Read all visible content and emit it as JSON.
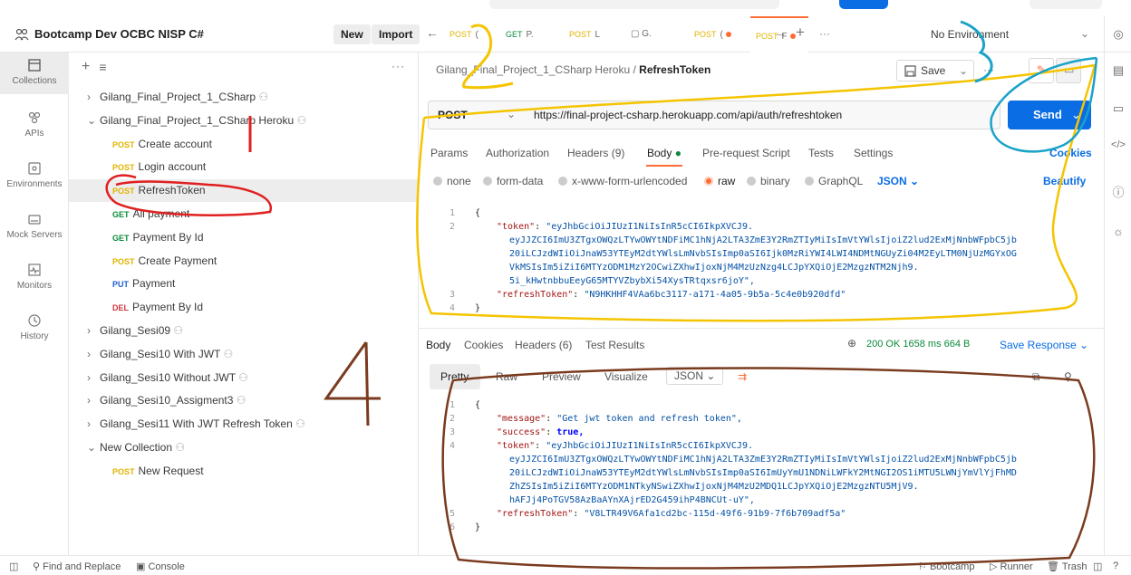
{
  "workspace": {
    "name": "Bootcamp Dev OCBC NISP C#",
    "new_label": "New",
    "import_label": "Import"
  },
  "rail": [
    {
      "label": "Collections",
      "icon": "collections-icon"
    },
    {
      "label": "APIs",
      "icon": "apis-icon"
    },
    {
      "label": "Environments",
      "icon": "environments-icon"
    },
    {
      "label": "Mock Servers",
      "icon": "mock-servers-icon"
    },
    {
      "label": "Monitors",
      "icon": "monitors-icon"
    },
    {
      "label": "History",
      "icon": "history-icon"
    }
  ],
  "tree": [
    {
      "kind": "collection",
      "label": "Gilang_Final_Project_1_CSharp",
      "expanded": false
    },
    {
      "kind": "collection",
      "label": "Gilang_Final_Project_1_CSharp Heroku",
      "expanded": true
    },
    {
      "kind": "request",
      "method": "POST",
      "label": "Create account"
    },
    {
      "kind": "request",
      "method": "POST",
      "label": "Login account"
    },
    {
      "kind": "request",
      "method": "POST",
      "label": "RefreshToken",
      "selected": true
    },
    {
      "kind": "request",
      "method": "GET",
      "label": "All payment"
    },
    {
      "kind": "request",
      "method": "GET",
      "label": "Payment By Id"
    },
    {
      "kind": "request",
      "method": "POST",
      "label": "Create Payment"
    },
    {
      "kind": "request",
      "method": "PUT",
      "label": "Payment"
    },
    {
      "kind": "request",
      "method": "DEL",
      "label": "Payment By Id"
    },
    {
      "kind": "collection",
      "label": "Gilang_Sesi09",
      "expanded": false
    },
    {
      "kind": "collection",
      "label": "Gilang_Sesi10 With JWT",
      "expanded": false
    },
    {
      "kind": "collection",
      "label": "Gilang_Sesi10 Without JWT",
      "expanded": false
    },
    {
      "kind": "collection",
      "label": "Gilang_Sesi10_Assigment3",
      "expanded": false
    },
    {
      "kind": "collection",
      "label": "Gilang_Sesi11 With JWT Refresh Token",
      "expanded": false
    },
    {
      "kind": "collection",
      "label": "New Collection",
      "expanded": true
    },
    {
      "kind": "request",
      "method": "POST",
      "label": "New Request"
    }
  ],
  "tabs": {
    "items": [
      {
        "method": "POST",
        "label": "("
      },
      {
        "method": "GET",
        "label": "P."
      },
      {
        "method": "POST",
        "label": "L"
      },
      {
        "method": "",
        "label": "G."
      },
      {
        "method": "POST",
        "label": "(",
        "unsaved": true
      },
      {
        "method": "POST",
        "label": "F",
        "unsaved": true,
        "active": true
      }
    ],
    "environment": "No Environment"
  },
  "request": {
    "breadcrumb_parent": "Gilang_Final_Project_1_CSharp Heroku",
    "breadcrumb_sep": "/",
    "breadcrumb_current": "RefreshToken",
    "save_label": "Save",
    "method": "POST",
    "url": "https://final-project-csharp.herokuapp.com/api/auth/refreshtoken",
    "send_label": "Send",
    "subtabs": [
      "Params",
      "Authorization",
      "Headers (9)",
      "Body",
      "Pre-request Script",
      "Tests",
      "Settings"
    ],
    "cookies_label": "Cookies",
    "body_types": [
      "none",
      "form-data",
      "x-www-form-urlencoded",
      "raw",
      "binary",
      "GraphQL"
    ],
    "body_format": "JSON",
    "beautify_label": "Beautify",
    "body_lines": [
      {
        "n": "1",
        "text": "{"
      },
      {
        "n": "2",
        "key": "\"token\"",
        "value": "\"eyJhbGciOiJIUzI1NiIsInR5cCI6IkpXVCJ9."
      },
      {
        "n": "",
        "value": "eyJJZCI6ImU3ZTgxOWQzLTYwOWYtNDFiMC1hNjA2LTA3ZmE3Y2RmZTIyMiIsImVtYWlsIjoiZ2lud2ExMjNnbWFpbC5jb"
      },
      {
        "n": "",
        "value": "20iLCJzdWIiOiJnaW53YTEyM2dtYWlsLmNvbSIsImp0aSI6Ijk0MzRiYWI4LWI4NDMtNGUyZi04M2EyLTM0NjUzMGYxOG"
      },
      {
        "n": "",
        "value": "VkMSIsIm5iZiI6MTYzODM1MzY2OCwiZXhwIjoxNjM4MzUzNzg4LCJpYXQiOjE2MzgzNTM2Njh9."
      },
      {
        "n": "",
        "value": "5i_kHwtnbbuEeyG65MTYVZbybXi54XysTRtqxsr6joY\","
      },
      {
        "n": "3",
        "key": "\"refreshToken\"",
        "value": "\"N9HKHHF4VAa6bc3117-a171-4a05-9b5a-5c4e0b920dfd\""
      },
      {
        "n": "4",
        "text": "}"
      }
    ]
  },
  "response": {
    "tabs": [
      "Body",
      "Cookies",
      "Headers (6)",
      "Test Results"
    ],
    "status": "200 OK",
    "time": "1658 ms",
    "size": "664 B",
    "save_label": "Save Response",
    "views": [
      "Pretty",
      "Raw",
      "Preview",
      "Visualize"
    ],
    "format": "JSON",
    "lines": [
      {
        "n": "1",
        "text": "{"
      },
      {
        "n": "2",
        "key": "\"message\"",
        "value": "\"Get jwt token and refresh token\","
      },
      {
        "n": "3",
        "key": "\"success\"",
        "bool": "true,"
      },
      {
        "n": "4",
        "key": "\"token\"",
        "value": "\"eyJhbGciOiJIUzI1NiIsInR5cCI6IkpXVCJ9."
      },
      {
        "n": "",
        "value": "eyJJZCI6ImU3ZTgxOWQzLTYwOWYtNDFiMC1hNjA2LTA3ZmE3Y2RmZTIyMiIsImVtYWlsIjoiZ2lud2ExMjNnbWFpbC5jb"
      },
      {
        "n": "",
        "value": "20iLCJzdWIiOiJnaW53YTEyM2dtYWlsLmNvbSIsImp0aSI6ImUyYmU1NDNiLWFkY2MtNGI2OS1iMTU5LWNjYmVlYjFhMD"
      },
      {
        "n": "",
        "value": "ZhZSIsIm5iZiI6MTYzODM1NTkyNSwiZXhwIjoxNjM4MzU2MDQ1LCJpYXQiOjE2MzgzNTU5MjV9."
      },
      {
        "n": "",
        "value": "hAFJj4PoTGV58AzBaAYnXAjrED2G459ihP4BNCUt-uY\","
      },
      {
        "n": "5",
        "key": "\"refreshToken\"",
        "value": "\"V8LTR49V6Afa1cd2bc-115d-49f6-91b9-7f6b709adf5a\""
      },
      {
        "n": "6",
        "text": "}"
      }
    ]
  },
  "footer": {
    "find_replace": "Find and Replace",
    "console": "Console",
    "bootcamp": "Bootcamp",
    "runner": "Runner",
    "trash": "Trash"
  },
  "annotations": {
    "n1": "1",
    "n2": "2",
    "n3": "3",
    "n4": "4"
  },
  "colors": {
    "accent": "#ff6c37",
    "send": "#0a6de3",
    "post": "#e0b400",
    "get": "#0a8a3a",
    "put": "#1c5fd0",
    "del": "#d1363d",
    "red_ink": "#e02020",
    "yellow_ink": "#f5c400",
    "cyan_ink": "#1aa3c8",
    "brown_ink": "#7a3b1f"
  }
}
